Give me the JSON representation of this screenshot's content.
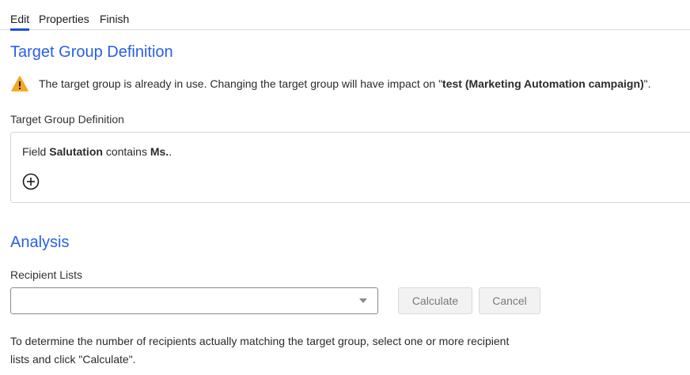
{
  "tabs": [
    {
      "label": "Edit",
      "active": true
    },
    {
      "label": "Properties",
      "active": false
    },
    {
      "label": "Finish",
      "active": false
    }
  ],
  "definition_section": {
    "title": "Target Group Definition",
    "warning": {
      "icon": "warning-triangle-icon",
      "color": "#f5a623",
      "text_before": "The target group is already in use. Changing the target group will have impact on \"",
      "campaign": "test (Marketing Automation campaign)",
      "text_after": "\"."
    },
    "field_label": "Target Group Definition",
    "rule": {
      "prefix": "Field",
      "field": "Salutation",
      "operator": "contains",
      "value": "Ms.",
      "suffix": "."
    },
    "add_icon": "plus-circle-icon"
  },
  "analysis_section": {
    "title": "Analysis",
    "recipients_label": "Recipient Lists",
    "recipients_selected": "",
    "calculate_label": "Calculate",
    "cancel_label": "Cancel",
    "help_text": "To determine the number of recipients actually matching the target group, select one or more recipient lists and click \"Calculate\"."
  },
  "colors": {
    "accent": "#2a5ee8",
    "tab_indicator": "#1f4fe0",
    "warning": "#f5a623"
  }
}
